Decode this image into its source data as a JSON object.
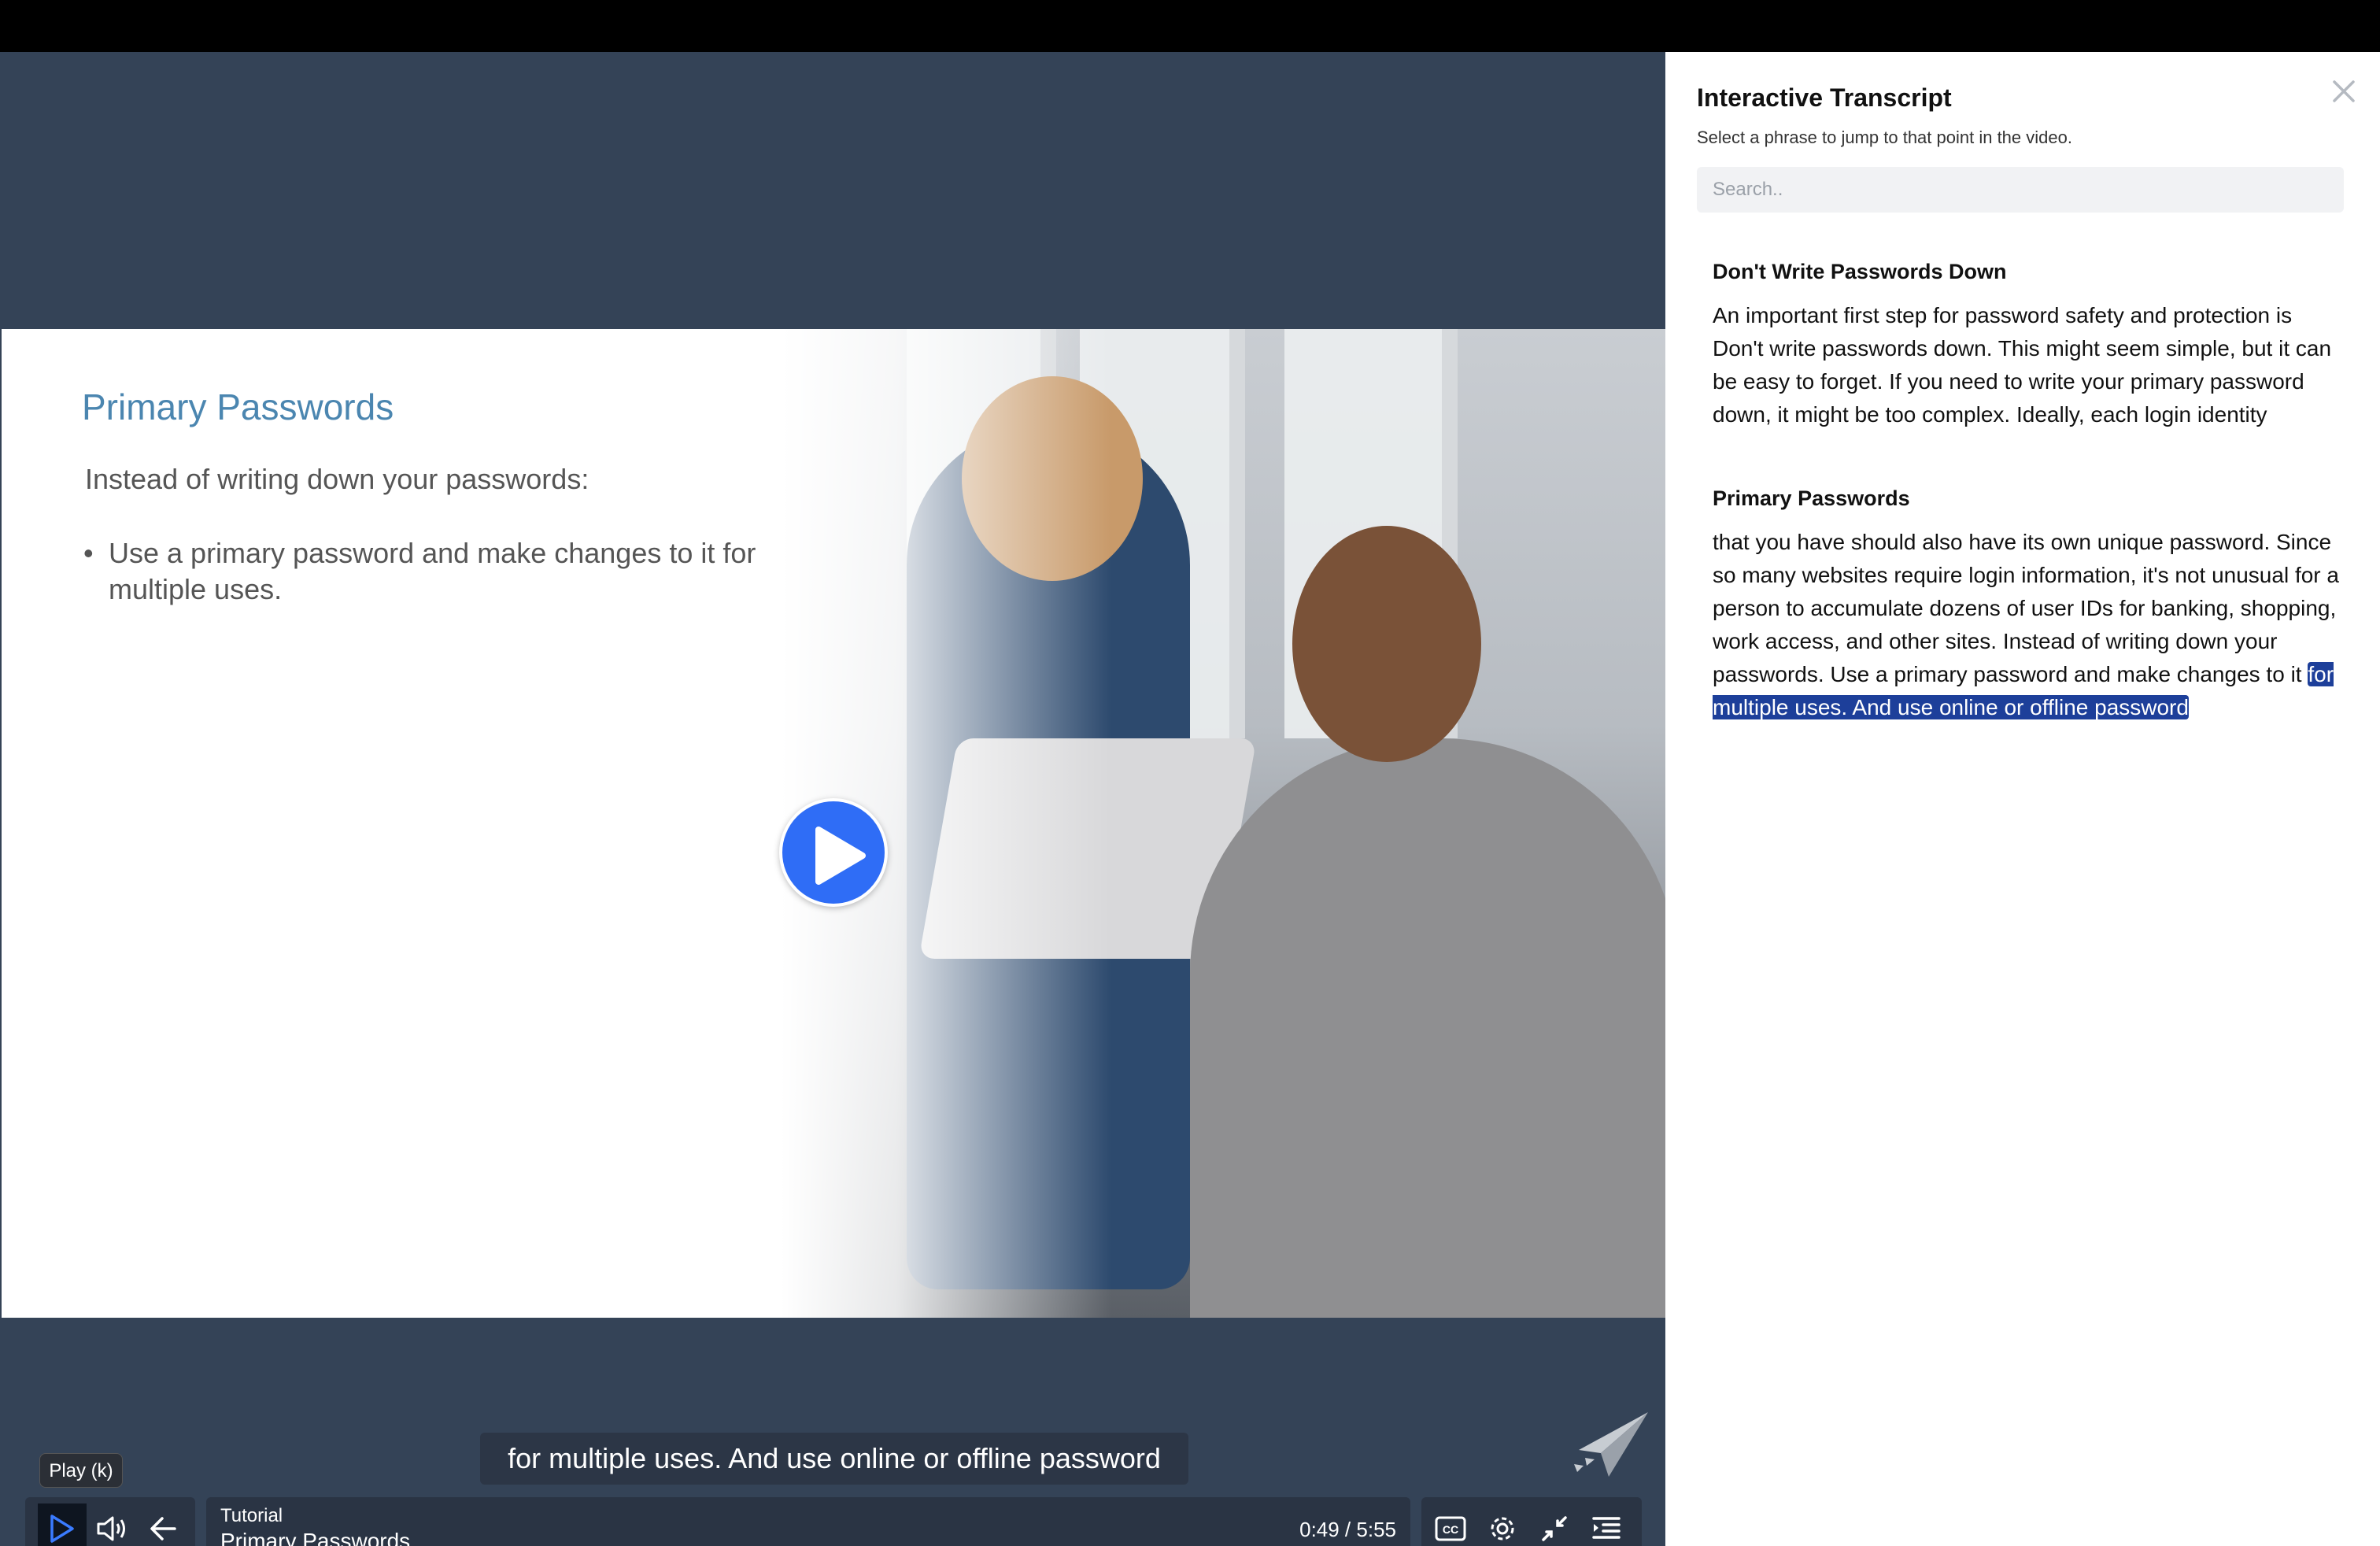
{
  "slide": {
    "title": "Primary Passwords",
    "intro": "Instead of writing down your passwords:",
    "bullet": "Use a primary password and make changes to it for multiple uses."
  },
  "caption": "for multiple uses. And use online or offline password",
  "tooltip": "Play (k)",
  "controls": {
    "media_type": "Tutorial",
    "media_title": "Primary Passwords",
    "time": "0:49 / 5:55"
  },
  "icons": {
    "play": "play-icon",
    "volume": "volume-icon",
    "back": "arrow-left-icon",
    "cc": "closed-captions-icon",
    "settings": "gear-icon",
    "exit_fullscreen": "collapse-icon",
    "transcript": "transcript-icon",
    "close": "close-icon"
  },
  "colors": {
    "accent": "#2f6df6",
    "player_bg": "#344357",
    "highlight": "#1d3f9a",
    "slide_title": "#4b86b0"
  },
  "transcript": {
    "title": "Interactive Transcript",
    "subtitle": "Select a phrase to jump to that point in the video.",
    "search_placeholder": "Search..",
    "sections": [
      {
        "heading": "Don't Write Passwords Down",
        "text": "An important first step for password safety and protection is Don't write passwords down. This might seem simple, but it can be easy to forget. If you need to write your primary password down, it might be too complex. Ideally, each login identity"
      },
      {
        "heading": "Primary Passwords",
        "text": "that you have should also have its own unique password. Since so many websites require login information, it's not unusual for a person to accumulate dozens of user IDs for banking, shopping, work access, and other sites. Instead of writing down your passwords. Use a primary password and make changes to it",
        "highlighted": "for multiple uses. And use online or offline password"
      }
    ]
  }
}
